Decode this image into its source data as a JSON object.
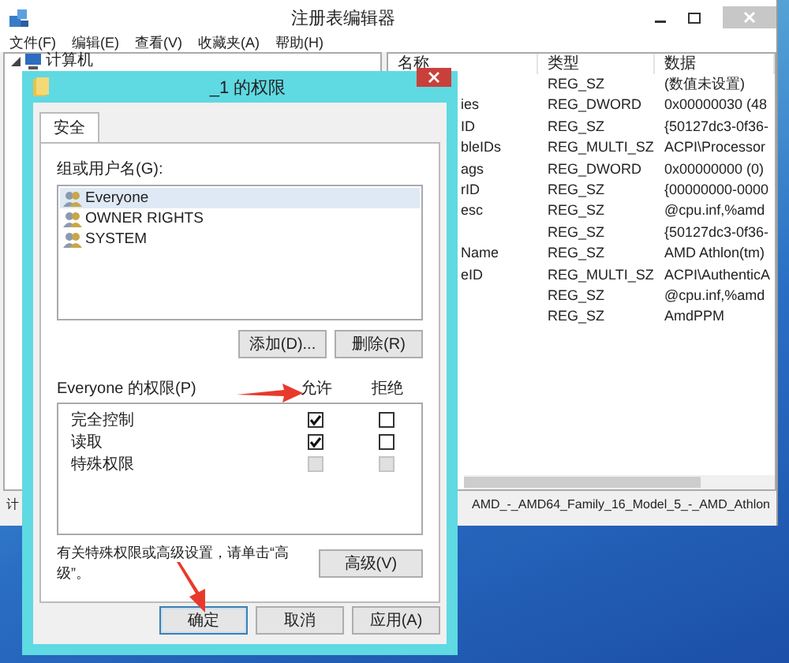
{
  "registry_editor": {
    "title": "注册表编辑器",
    "menu": [
      "文件(F)",
      "编辑(E)",
      "查看(V)",
      "收藏夹(A)",
      "帮助(H)"
    ],
    "tree": [
      {
        "label": "计算机",
        "expanded": true
      }
    ],
    "columns": [
      "名称",
      "类型",
      "数据"
    ],
    "rows": [
      {
        "type": "REG_SZ",
        "data": "(数值未设置)"
      },
      {
        "name": "ies",
        "type": "REG_DWORD",
        "data": "0x00000030 (48"
      },
      {
        "name": "ID",
        "type": "REG_SZ",
        "data": "{50127dc3-0f36-"
      },
      {
        "name": "bleIDs",
        "type": "REG_MULTI_SZ",
        "data": "ACPI\\Processor"
      },
      {
        "name": "ags",
        "type": "REG_DWORD",
        "data": "0x00000000 (0)"
      },
      {
        "name": "rID",
        "type": "REG_SZ",
        "data": "{00000000-0000"
      },
      {
        "name": "esc",
        "type": "REG_SZ",
        "data": "@cpu.inf,%amd"
      },
      {
        "type": "REG_SZ",
        "data": "{50127dc3-0f36-"
      },
      {
        "name": "Name",
        "type": "REG_SZ",
        "data": "AMD Athlon(tm)"
      },
      {
        "name": "eID",
        "type": "REG_MULTI_SZ",
        "data": "ACPI\\AuthenticA"
      },
      {
        "type": "REG_SZ",
        "data": "@cpu.inf,%amd"
      },
      {
        "type": "REG_SZ",
        "data": "AmdPPM"
      }
    ],
    "status_bar": {
      "left": "计",
      "right": "AMD_-_AMD64_Family_16_Model_5_-_AMD_Athlon"
    }
  },
  "dialog": {
    "title": "_1 的权限",
    "tabs": [
      {
        "label": "安全",
        "selected": true
      }
    ],
    "group_label": "组或用户名(G):",
    "users": [
      {
        "name": "Everyone",
        "selected": true
      },
      {
        "name": "OWNER RIGHTS",
        "selected": false
      },
      {
        "name": "SYSTEM",
        "selected": false
      }
    ],
    "user_buttons": [
      "添加(D)...",
      "删除(R)"
    ],
    "permissions_label": "Everyone 的权限(P)",
    "permission_columns": [
      "允许",
      "拒绝"
    ],
    "permissions": [
      {
        "name": "完全控制",
        "allow": true,
        "deny": false,
        "disabled": false
      },
      {
        "name": "读取",
        "allow": true,
        "deny": false,
        "disabled": false
      },
      {
        "name": "特殊权限",
        "allow": false,
        "deny": false,
        "disabled": true
      }
    ],
    "advanced_note": "有关特殊权限或高级设置，请单击“高级”。",
    "advanced_button": "高级(V)",
    "buttons": [
      {
        "label": "确定",
        "focused": true
      },
      {
        "label": "取消",
        "focused": false
      },
      {
        "label": "应用(A)",
        "focused": false
      }
    ]
  }
}
